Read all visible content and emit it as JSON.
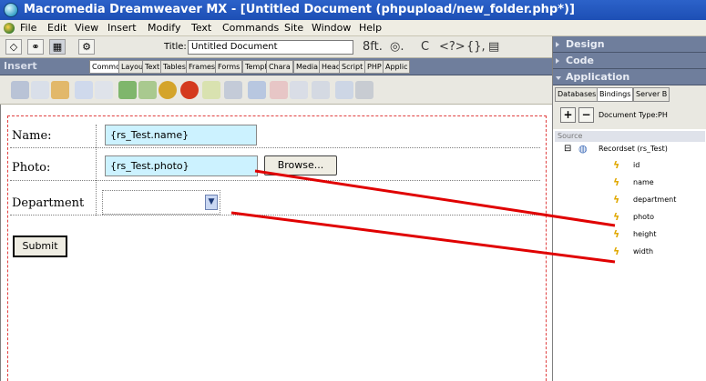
{
  "window": {
    "title": "Macromedia Dreamweaver MX - [Untitled Document (phpupload/new_folder.php*)]"
  },
  "menubar": {
    "items": [
      "File",
      "Edit",
      "View",
      "Insert",
      "Modify",
      "Text",
      "Commands",
      "Site",
      "Window",
      "Help"
    ]
  },
  "doc_toolbar": {
    "title_label": "Title:",
    "title_value": "Untitled Document",
    "brackets": "{},"
  },
  "insert_panel": {
    "title": "Insert",
    "tabs": [
      "Common",
      "Layout",
      "Text",
      "Tables",
      "Frames",
      "Forms",
      "Templ",
      "Chara",
      "Media",
      "Head",
      "Script",
      "PHP",
      "Applic"
    ]
  },
  "form": {
    "name_label": "Name:",
    "name_value": "{rs_Test.name}",
    "photo_label": "Photo:",
    "photo_value": "{rs_Test.photo}",
    "browse_label": "Browse...",
    "department_label": "Department",
    "submit_label": "Submit"
  },
  "right_panels": {
    "design": "Design",
    "code": "Code",
    "application": "Application",
    "tabs": [
      "Databases",
      "Bindings",
      "Server B"
    ],
    "document_type": "Document Type:PH",
    "source_label": "Source",
    "recordset": "Recordset (rs_Test)",
    "fields": [
      "id",
      "name",
      "department",
      "photo",
      "height",
      "width"
    ]
  },
  "colors": {
    "titlebar": "#2456c2",
    "panel_header": "#6f7e9c",
    "binding_field": "#ccf2ff",
    "connector": "#e00000"
  }
}
